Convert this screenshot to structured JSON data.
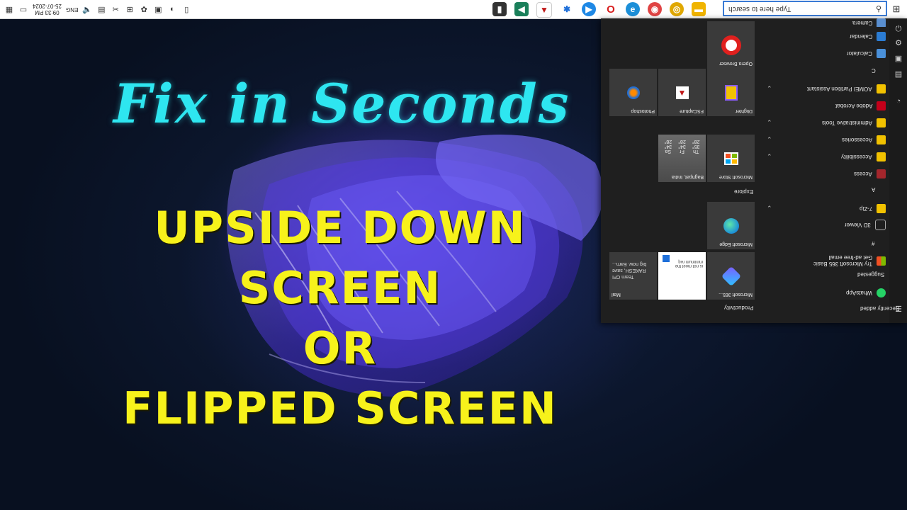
{
  "taskbar": {
    "clock_time": "09:33 PM",
    "clock_date": "25-07-2024",
    "language": "ENG",
    "search_placeholder": "Type here to search",
    "pinned_apps": [
      {
        "icon": "media-icon",
        "color": "#333333"
      },
      {
        "icon": "arrow-icon",
        "color": "#1a7f5a"
      },
      {
        "icon": "fscapture-icon",
        "color": "#c01818"
      },
      {
        "icon": "bug-icon",
        "color": "#1e6fd9"
      },
      {
        "icon": "play-icon",
        "color": "#1e88e5"
      },
      {
        "icon": "opera-icon",
        "color": "#d81e1e"
      },
      {
        "icon": "edge-icon",
        "color": "#1c8fd8"
      },
      {
        "icon": "browser-icon",
        "color": "#e04444"
      },
      {
        "icon": "chrome-icon",
        "color": "#e0a800"
      },
      {
        "icon": "folder-icon",
        "color": "#f0b400"
      }
    ]
  },
  "start_menu": {
    "headers": {
      "recently_added": "Recently added",
      "suggested": "Suggested",
      "hash": "#",
      "letter_a": "A",
      "letter_c": "C"
    },
    "apps": [
      {
        "label": "WhatsApp",
        "color": "#25d366"
      },
      {
        "label": "Try Microsoft 365 Basic",
        "sub": "Get ad-free email",
        "color": "#0078d4"
      },
      {
        "label": "3D Viewer",
        "color": "#6a6a6a"
      },
      {
        "label": "7-Zip",
        "color": "#f2c200"
      },
      {
        "label": "Access",
        "color": "#a4262c"
      },
      {
        "label": "Accessibility",
        "color": "#f2c200"
      },
      {
        "label": "Accessories",
        "color": "#f2c200"
      },
      {
        "label": "Administrative Tools",
        "color": "#f2c200"
      },
      {
        "label": "Adobe Acrobat",
        "color": "#c4001a"
      },
      {
        "label": "AOMEI Partition Assistant",
        "color": "#f2c200"
      },
      {
        "label": "Calculator",
        "color": "#4a90d9"
      },
      {
        "label": "Calendar",
        "color": "#2b7cd3"
      },
      {
        "label": "Camera",
        "color": "#5a8fd0"
      }
    ],
    "groups": {
      "productivity": "Productivity",
      "explore": "Explore"
    },
    "tiles": [
      {
        "label": "Microsoft 365...",
        "color": "#3a3a3a"
      },
      {
        "label": "",
        "color": "#ffffff"
      },
      {
        "label": "Mail",
        "color": "#3a3a3a"
      },
      {
        "label": "Microsoft Edge",
        "color": "#3a3a3a"
      },
      {
        "label": "Microsoft Store",
        "color": "#3a3a3a"
      },
      {
        "label": "Baghpat, India",
        "color": "#5a5a5a"
      },
      {
        "label": "Dlighter",
        "color": "#3a3a3a"
      },
      {
        "label": "FSCapture",
        "color": "#3a3a3a"
      },
      {
        "label": "Photoshop",
        "color": "#3a3a3a"
      },
      {
        "label": "Opera Browser",
        "color": "#3a3a3a"
      }
    ],
    "mail_preview": {
      "from": "Team CFI",
      "line1": "RAKESH, save",
      "line2": "big now. Earn..."
    },
    "office_preview": "is not meet the minimum req",
    "weather": {
      "days": [
        "Th",
        "Fr",
        "Sa"
      ],
      "highs": [
        "35°",
        "34°",
        "34°"
      ],
      "lows": [
        "28°",
        "28°",
        "28°"
      ]
    }
  },
  "overlay": {
    "script_title": "Fix in Seconds",
    "line1": "UPSIDE DOWN",
    "line2": "SCREEN",
    "line3": "OR",
    "line4": "FLIPPED SCREEN",
    "script_color": "#2ee6f0",
    "headline_color": "#f7f21b"
  }
}
